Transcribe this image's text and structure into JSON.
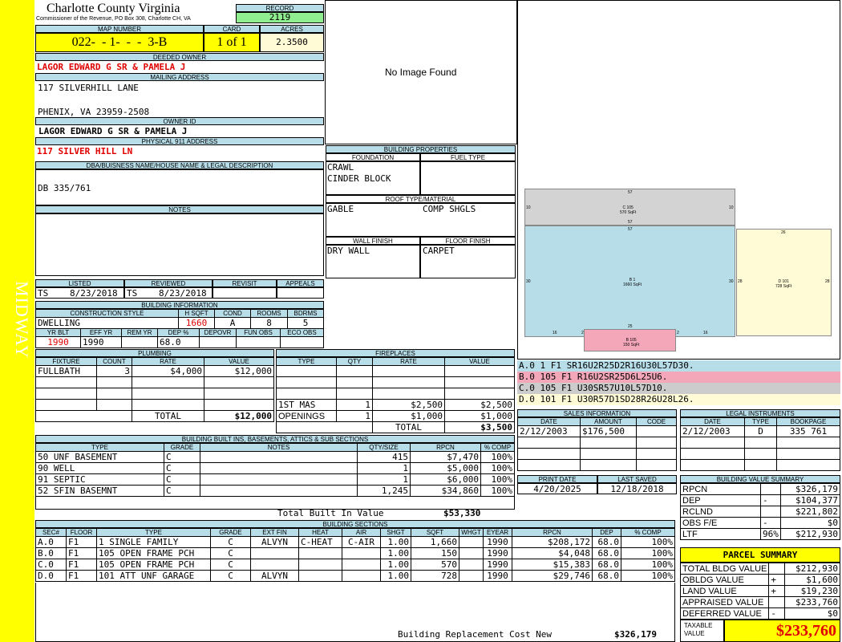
{
  "sidebar": {
    "text": "MIDWAY"
  },
  "header": {
    "county": "Charlotte County Virginia",
    "address": "Commissioner of the Revenue, PO Box 308, Charlotte CH, VA",
    "record_label": "RECORD",
    "record_value": "2119",
    "map_label": "MAP NUMBER",
    "map_value": "022-  - 1-  -  -  3-B",
    "card_label": "CARD",
    "card_value": "1 of 1",
    "acres_label": "ACRES",
    "acres_value": "2.3500"
  },
  "owner": {
    "deeded_label": "DEEDED OWNER",
    "deeded_value": "LAGOR EDWARD G SR & PAMELA J",
    "mailing_label": "MAILING ADDRESS",
    "mailing_line1": "117 SILVERHILL LANE",
    "mailing_line2": "PHENIX, VA 23959-2508",
    "ownerid_label": "OWNER ID",
    "ownerid_value": "LAGOR EDWARD G SR & PAMELA J",
    "physical_label": "PHYSICAL 911 ADDRESS",
    "physical_value": "117 SILVER HILL LN",
    "dba_label": "DBA/BUISNESS NAME/HOUSE NAME & LEGAL DESCRIPTION",
    "dba_value": "DB 335/761",
    "notes_label": "NOTES"
  },
  "image": {
    "text": "No Image Found"
  },
  "review": {
    "listed_label": "LISTED",
    "reviewed_label": "REVIEWED",
    "revisit_label": "REVISIT",
    "appeals_label": "APPEALS",
    "listed_by": "TS",
    "listed_date": "8/23/2018",
    "reviewed_by": "TS",
    "reviewed_date": "8/23/2018"
  },
  "building_info": {
    "title": "BUILDING INFORMATION",
    "style_label": "CONSTRUCTION STYLE",
    "hsqft_label": "H SQFT",
    "cond_label": "COND",
    "rooms_label": "ROOMS",
    "bdrms_label": "BDRMS",
    "style": "DWELLING",
    "hsqft": "1660",
    "cond": "A",
    "rooms": "8",
    "bdrms": "5",
    "yrblt_label": "YR BLT",
    "effyr_label": "EFF YR",
    "remyr_label": "REM YR",
    "dep_label": "DEP %",
    "depovr_label": "DEPOVR",
    "funobs_label": "FUN OBS",
    "ecoobs_label": "ECO OBS",
    "yrblt": "1990",
    "effyr": "1990",
    "remyr": "",
    "dep": "68.0",
    "depovr": "",
    "funobs": "",
    "ecoobs": ""
  },
  "properties": {
    "title": "BUILDING PROPERTIES",
    "foundation_label": "FOUNDATION",
    "fueltype_label": "FUEL TYPE",
    "foundation1": "CRAWL",
    "foundation2": "CINDER BLOCK",
    "roof_label": "ROOF TYPE/MATERIAL",
    "roof_type": "GABLE",
    "roof_material": "COMP SHGLS",
    "wall_label": "WALL FINISH",
    "floor_label": "FLOOR FINISH",
    "wall": "DRY WALL",
    "floor": "CARPET"
  },
  "plumbing": {
    "title": "PLUMBING",
    "headers": [
      "FIXTURE",
      "COUNT",
      "RATE",
      "VALUE"
    ],
    "rows": [
      [
        "FULLBATH",
        "3",
        "$4,000",
        "$12,000"
      ],
      [
        "",
        "",
        "",
        ""
      ],
      [
        "",
        "",
        "",
        ""
      ],
      [
        "",
        "",
        "",
        ""
      ]
    ],
    "total_label": "TOTAL",
    "total": "$12,000"
  },
  "fireplaces": {
    "title": "FIREPLACES",
    "headers": [
      "TYPE",
      "QTY",
      "RATE",
      "VALUE"
    ],
    "rows": [
      [
        "",
        "",
        "",
        ""
      ],
      [
        "",
        "",
        "",
        ""
      ],
      [
        "",
        "",
        "",
        ""
      ],
      [
        "1ST MAS",
        "1",
        "$2,500",
        "$2,500"
      ],
      [
        "OPENINGS",
        "1",
        "$1,000",
        "$1,000"
      ]
    ],
    "total_label": "TOTAL",
    "total": "$3,500"
  },
  "builtins": {
    "title": "BUILDING BUILT INS, BASEMENTS, ATTICS & SUB SECTIONS",
    "headers": [
      "TYPE",
      "GRADE",
      "NOTES",
      "QTY/SIZE",
      "RPCN",
      "% COMP"
    ],
    "rows": [
      [
        "50 UNF BASEMENT",
        "C",
        "",
        "415",
        "$7,470",
        "100%"
      ],
      [
        "90 WELL",
        "C",
        "",
        "1",
        "$5,000",
        "100%"
      ],
      [
        "91 SEPTIC",
        "C",
        "",
        "1",
        "$6,000",
        "100%"
      ],
      [
        "52 SFIN BASEMNT",
        "C",
        "",
        "1,245",
        "$34,860",
        "100%"
      ]
    ],
    "total_label": "Total Built In Value",
    "total": "$53,330"
  },
  "sketch": {
    "labels": [
      "A.0 1 F1 SR16U2R25D2R16U30L57D30.",
      "B.0 105 F1 R16U2SR25D6L25U6.",
      "C.0 105 F1 U30SR57U10L57D10.",
      "D.0 101 F1 U30R57D1SD28R26U28L26."
    ],
    "colors": [
      "#b7dde8",
      "#f4a7b9",
      "#cccccc",
      "#fffbd6"
    ],
    "area_a": "B 1\n1660 SqFt",
    "area_b": "B 105\n150 SqFt",
    "area_c": "C 105\n570 SqFt",
    "area_d": "D 101\n728 SqFt",
    "dim_57": "57",
    "dim_10": "10",
    "dim_30": "30",
    "dim_25": "25",
    "dim_26": "26",
    "dim_28": "28",
    "dim_16": "16",
    "dim_2": "2"
  },
  "sales": {
    "title": "SALES INFORMATION",
    "headers": [
      "DATE",
      "AMOUNT",
      "CODE"
    ],
    "rows": [
      [
        "2/12/2003",
        "$176,500",
        ""
      ]
    ]
  },
  "legal": {
    "title": "LEGAL INSTRUMENTS",
    "headers": [
      "DATE",
      "TYPE",
      "BOOKPAGE"
    ],
    "rows": [
      [
        "2/12/2003",
        "D",
        "335 761"
      ]
    ]
  },
  "dates": {
    "print_label": "PRINT DATE",
    "saved_label": "LAST SAVED",
    "print": "4/20/2025",
    "saved": "12/18/2018"
  },
  "value_summary": {
    "title": "BUILDING VALUE SUMMARY",
    "rows": [
      [
        "RPCN",
        "",
        "$326,179"
      ],
      [
        "DEP",
        "-",
        "$104,377"
      ],
      [
        "RCLND",
        "",
        "$221,802"
      ],
      [
        "OBS F/E",
        "-",
        "$0"
      ],
      [
        "LTF",
        "96%",
        "$212,930"
      ]
    ]
  },
  "sections": {
    "title": "BUILDING SECTIONS",
    "headers": [
      "SEC#",
      "FLOOR",
      "TYPE",
      "GRADE",
      "EXT FIN",
      "HEAT",
      "AIR",
      "SHGT",
      "SQFT",
      "WHGT",
      "EYEAR",
      "RPCN",
      "DEP",
      "% COMP"
    ],
    "rows": [
      [
        "A.0",
        "F1",
        "1 SINGLE FAMILY",
        "C",
        "ALVYN",
        "C-HEAT",
        "C-AIR",
        "1.00",
        "1,660",
        "",
        "1990",
        "$208,172",
        "68.0",
        "100%"
      ],
      [
        "B.0",
        "F1",
        "105 OPEN FRAME PCH",
        "C",
        "",
        "",
        "",
        "1.00",
        "150",
        "",
        "1990",
        "$4,048",
        "68.0",
        "100%"
      ],
      [
        "C.0",
        "F1",
        "105 OPEN FRAME PCH",
        "C",
        "",
        "",
        "",
        "1.00",
        "570",
        "",
        "1990",
        "$15,383",
        "68.0",
        "100%"
      ],
      [
        "D.0",
        "F1",
        "101 ATT UNF GARAGE",
        "C",
        "ALVYN",
        "",
        "",
        "1.00",
        "728",
        "",
        "1990",
        "$29,746",
        "68.0",
        "100%"
      ]
    ],
    "total_label": "Building Replacement Cost New",
    "total": "$326,179"
  },
  "parcel": {
    "title": "PARCEL SUMMARY",
    "rows": [
      [
        "TOTAL BLDG VALUE",
        "",
        "$212,930"
      ],
      [
        "OBLDG VALUE",
        "+",
        "$1,600"
      ],
      [
        "LAND VALUE",
        "+",
        "$19,230"
      ],
      [
        "APPRAISED VALUE",
        "",
        "$233,760"
      ],
      [
        "DEFERRED VALUE",
        "-",
        "$0"
      ]
    ],
    "taxable_label": "TAXABLE VALUE",
    "taxable": "$233,760"
  }
}
